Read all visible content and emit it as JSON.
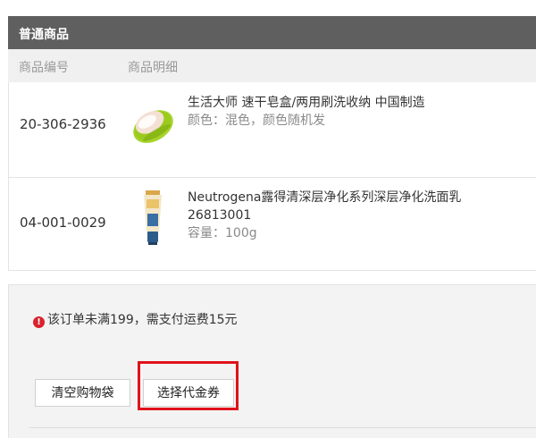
{
  "section": {
    "title": "普通商品"
  },
  "columns": {
    "code": "商品编号",
    "detail": "商品明细"
  },
  "items": [
    {
      "code": "20-306-2936",
      "name": "生活大师 速干皂盒/两用刷洗收纳 中国制造",
      "attr": "颜色：混色，颜色随机发",
      "image_icon": "soap-dish-image"
    },
    {
      "code": "04-001-0029",
      "name_line1": "Neutrogena露得清深层净化系列深层净化洗面乳",
      "name_line2": "26813001",
      "attr": "容量：100g",
      "image_icon": "cleanser-tube-image"
    }
  ],
  "summary": {
    "notice_icon": "!",
    "notice": "该订单未满199，需支付运费15元",
    "clear_cart": "清空购物袋",
    "choose_coupon": "选择代金券"
  },
  "colors": {
    "header_bar": "#5f5f5f",
    "highlight": "#e0121b",
    "warn": "#d9232e"
  }
}
